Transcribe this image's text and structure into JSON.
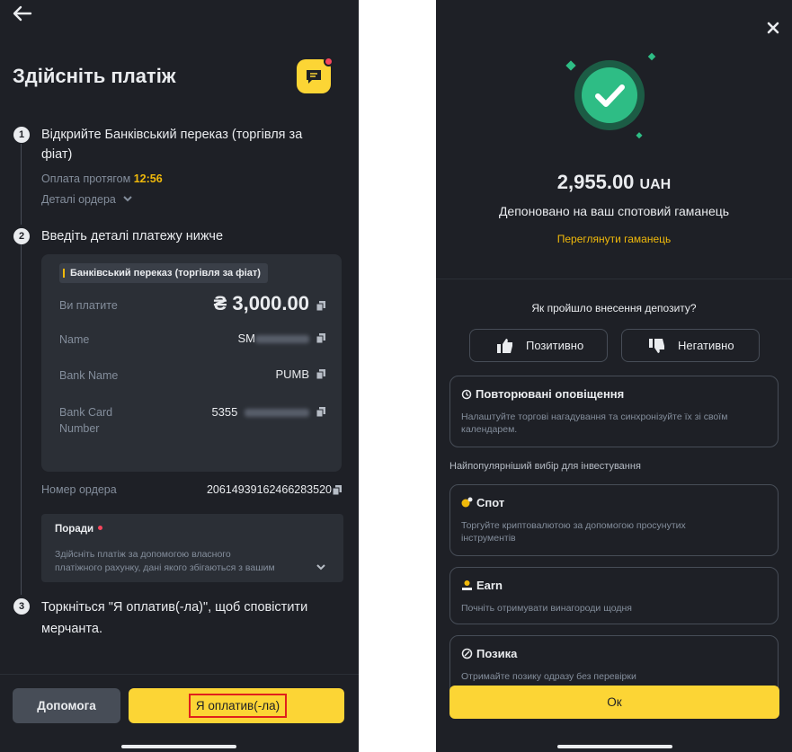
{
  "left": {
    "title": "Здійсніть платіж",
    "steps": [
      {
        "number": "1",
        "line1": "Відкрийте Банківський переказ (торгівля за",
        "line2": "фіат)",
        "payment_prefix": "Оплата протягом",
        "timer": "12:56",
        "order_details_label": "Деталі ордера"
      },
      {
        "number": "2",
        "text": "Введіть деталі платежу нижче"
      },
      {
        "number": "3",
        "line1": "Торкніться \"Я оплатив(-ла)\", щоб сповістити",
        "line2": "мерчанта."
      }
    ],
    "payment_card": {
      "method_tag": "Банківський переказ (торгівля за фіат)",
      "rows": [
        {
          "label": "Ви платите",
          "value": "₴ 3,000.00"
        },
        {
          "label": "Name",
          "value": "SM"
        },
        {
          "label": "Bank Name",
          "value": "PUMB"
        },
        {
          "label": "Bank Card",
          "label2": "Number",
          "value": "5355"
        }
      ]
    },
    "order": {
      "label": "Номер ордера",
      "value": "20614939162466283520"
    },
    "tips": {
      "title": "Поради",
      "text_line1": "Здійсніть платіж за допомогою власного",
      "text_line2": "платіжного рахунку, дані якого збігаються з вашим"
    },
    "help_button": "Допомога",
    "paid_button": "Я оплатив(-ла)"
  },
  "right": {
    "amount": "2,955.00",
    "currency": "UAH",
    "deposited_text": "Депоновано на ваш спотовий гаманець",
    "view_wallet": "Переглянути гаманець",
    "feedback_question": "Як пройшло внесення депозиту?",
    "positive_label": "Позитивно",
    "negative_label": "Негативно",
    "recurring": {
      "title": "Повторювані оповіщення",
      "desc_line1": "Налаштуйте торгові нагадування та синхронізуйте їх зі своїм",
      "desc_line2": "календарем."
    },
    "section_label": "Найпопулярніший вибір для інвестування",
    "products": [
      {
        "title": "Спот",
        "desc_line1": "Торгуйте криптовалютою за допомогою просунутих",
        "desc_line2": "інструментів"
      },
      {
        "title": "Earn",
        "desc_line1": "Почніть отримувати винагороди щодня"
      },
      {
        "title": "Позика",
        "desc_line1": "Отримайте позику одразу без перевірки"
      }
    ],
    "ok_button": "Ок"
  },
  "colors": {
    "background": "#1e2026",
    "card": "#2b2f36",
    "accent_yellow": "#fcd535",
    "timer_yellow": "#f0b90b",
    "success_green": "#2ebd85",
    "alert_red": "#f6465d",
    "highlight_box": "#e0201c"
  },
  "icons": {
    "back": "arrow-left-icon",
    "chat": "chat-icon",
    "copy": "copy-icon",
    "chevron": "chevron-down-icon",
    "close": "close-icon",
    "success": "check-circle-icon",
    "thumbs_up": "thumbs-up-icon",
    "thumbs_down": "thumbs-down-icon",
    "recurring": "repeat-icon",
    "spot": "spot-icon",
    "earn": "earn-icon",
    "loan": "loan-icon"
  }
}
